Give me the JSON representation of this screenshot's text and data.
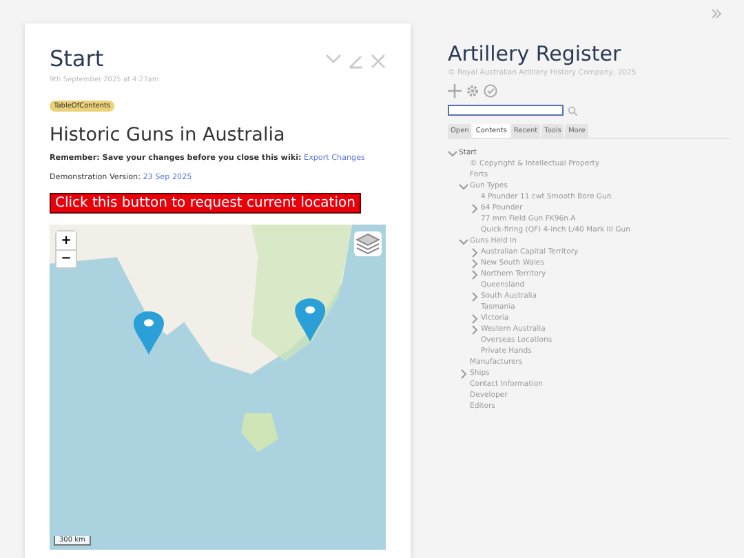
{
  "story": {
    "title": "Start",
    "date": "9th September 2025 at 4:27am",
    "tag": "TableOfContents",
    "heading": "Historic Guns in Australia",
    "reminder": "**Remember: Save your changes before you close this wiki:** ",
    "reminder_link": "Export Changes",
    "version_label": "Demonstration Version: ",
    "version_link": "23 Sep 2025",
    "location_button": "Click this button to request current location",
    "map": {
      "zoom_in": "+",
      "zoom_out": "−",
      "scale": "300 km"
    }
  },
  "sidebar": {
    "title": "Artillery Register",
    "subtitle": "© Royal Australian Artillery History Company, 2025",
    "tabs": [
      {
        "label": "Open",
        "selected": false
      },
      {
        "label": "Contents",
        "selected": true
      },
      {
        "label": "Recent",
        "selected": false
      },
      {
        "label": "Tools",
        "selected": false
      },
      {
        "label": "More",
        "selected": false
      }
    ],
    "tree": [
      {
        "label": "Start",
        "expanded": true,
        "children": [
          {
            "label": "© Copyright & Intellectual Property"
          },
          {
            "label": "Forts"
          },
          {
            "label": "Gun Types",
            "expanded": true,
            "children": [
              {
                "label": "4 Pounder 11 cwt Smooth Bore Gun"
              },
              {
                "label": "64 Pounder",
                "expanded": false
              },
              {
                "label": "77 mm Field Gun FK96n.A"
              },
              {
                "label": "Quick-firing (QF) 4-inch L/40 Mark III Gun"
              }
            ]
          },
          {
            "label": "Guns Held In",
            "expanded": true,
            "children": [
              {
                "label": "Australian Capital Territory",
                "expanded": false
              },
              {
                "label": "New South Wales",
                "expanded": false
              },
              {
                "label": "Northern Territory",
                "expanded": false
              },
              {
                "label": "Queensland"
              },
              {
                "label": "South Australia",
                "expanded": false
              },
              {
                "label": "Tasmania"
              },
              {
                "label": "Victoria",
                "expanded": false
              },
              {
                "label": "Western Australia",
                "expanded": false
              },
              {
                "label": "Overseas Locations"
              },
              {
                "label": "Private Hands"
              }
            ]
          },
          {
            "label": "Manufacturers"
          },
          {
            "label": "Ships",
            "expanded": false
          },
          {
            "label": "Contact Information"
          },
          {
            "label": "Developer"
          },
          {
            "label": "Editors"
          }
        ]
      }
    ]
  }
}
